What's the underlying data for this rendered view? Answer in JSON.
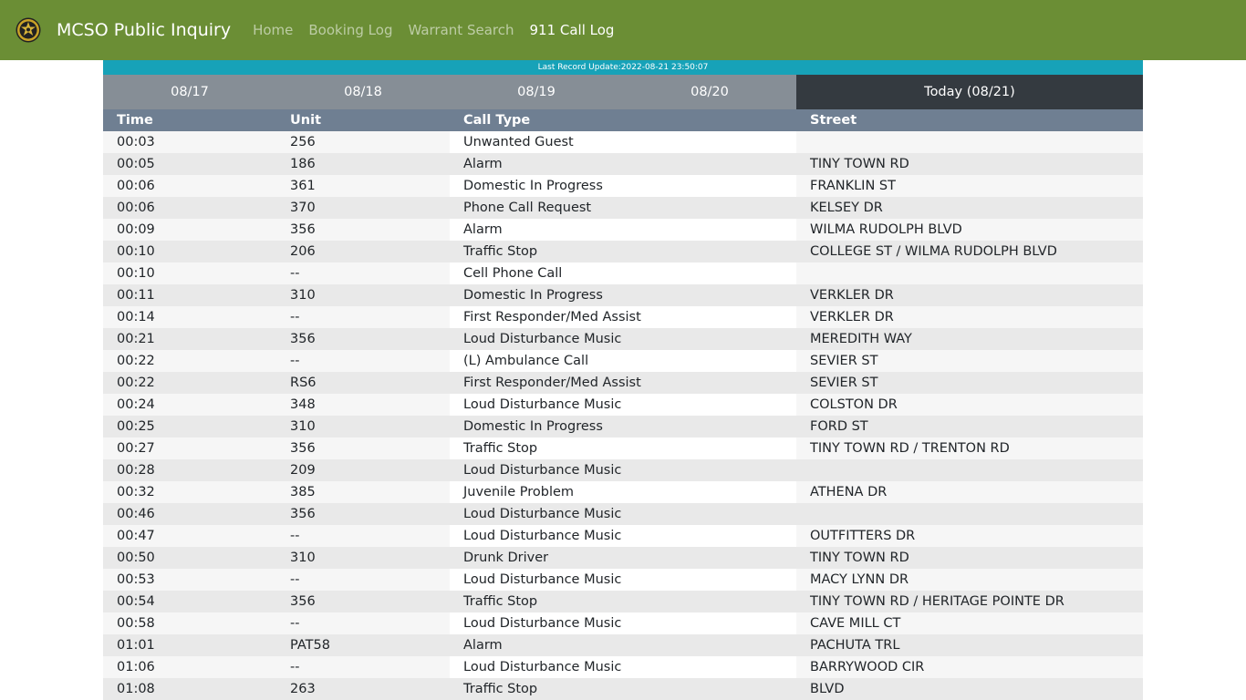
{
  "header": {
    "brand": "MCSO Public Inquiry",
    "nav": [
      {
        "label": "Home",
        "active": false
      },
      {
        "label": "Booking Log",
        "active": false
      },
      {
        "label": "Warrant Search",
        "active": false
      },
      {
        "label": "911 Call Log",
        "active": true
      }
    ],
    "logo_icon": "sheriff-star-badge-icon"
  },
  "update": {
    "text": "Last Record Update:2022-08-21 23:50:07"
  },
  "day_tabs": [
    {
      "label": "08/17",
      "active": false
    },
    {
      "label": "08/18",
      "active": false
    },
    {
      "label": "08/19",
      "active": false
    },
    {
      "label": "08/20",
      "active": false
    },
    {
      "label": "Today (08/21)",
      "active": true
    }
  ],
  "table": {
    "headers": [
      "Time",
      "Unit",
      "Call Type",
      "Street"
    ],
    "rows": [
      [
        "00:03",
        "256",
        "Unwanted Guest",
        ""
      ],
      [
        "00:05",
        "186",
        "Alarm",
        "TINY TOWN RD"
      ],
      [
        "00:06",
        "361",
        "Domestic In Progress",
        "FRANKLIN ST"
      ],
      [
        "00:06",
        "370",
        "Phone Call Request",
        "KELSEY DR"
      ],
      [
        "00:09",
        "356",
        "Alarm",
        "WILMA RUDOLPH BLVD"
      ],
      [
        "00:10",
        "206",
        "Traffic Stop",
        "COLLEGE ST / WILMA RUDOLPH BLVD"
      ],
      [
        "00:10",
        "--",
        "Cell Phone Call",
        ""
      ],
      [
        "00:11",
        "310",
        "Domestic In Progress",
        "VERKLER DR"
      ],
      [
        "00:14",
        "--",
        "First Responder/Med Assist",
        "VERKLER DR"
      ],
      [
        "00:21",
        "356",
        "Loud Disturbance Music",
        "MEREDITH WAY"
      ],
      [
        "00:22",
        "--",
        "(L) Ambulance Call",
        "SEVIER ST"
      ],
      [
        "00:22",
        "RS6",
        "First Responder/Med Assist",
        "SEVIER ST"
      ],
      [
        "00:24",
        "348",
        "Loud Disturbance Music",
        "COLSTON DR"
      ],
      [
        "00:25",
        "310",
        "Domestic In Progress",
        "FORD ST"
      ],
      [
        "00:27",
        "356",
        "Traffic Stop",
        "TINY TOWN RD / TRENTON RD"
      ],
      [
        "00:28",
        "209",
        "Loud Disturbance Music",
        ""
      ],
      [
        "00:32",
        "385",
        "Juvenile Problem",
        "ATHENA DR"
      ],
      [
        "00:46",
        "356",
        "Loud Disturbance Music",
        ""
      ],
      [
        "00:47",
        "--",
        "Loud Disturbance Music",
        "OUTFITTERS DR"
      ],
      [
        "00:50",
        "310",
        "Drunk Driver",
        "TINY TOWN RD"
      ],
      [
        "00:53",
        "--",
        "Loud Disturbance Music",
        "MACY LYNN DR"
      ],
      [
        "00:54",
        "356",
        "Traffic Stop",
        "TINY TOWN RD / HERITAGE POINTE DR"
      ],
      [
        "00:58",
        "--",
        "Loud Disturbance Music",
        "CAVE MILL CT"
      ],
      [
        "01:01",
        "PAT58",
        "Alarm",
        "PACHUTA TRL"
      ],
      [
        "01:06",
        "--",
        "Loud Disturbance Music",
        "BARRYWOOD CIR"
      ],
      [
        "01:08",
        "263",
        "Traffic Stop",
        "BLVD"
      ]
    ]
  },
  "colors": {
    "navbar": "#6b8e35",
    "update_bar": "#17a2b8",
    "tab_inactive": "#868e96",
    "tab_active": "#343a40",
    "table_header": "#6f7f92"
  }
}
